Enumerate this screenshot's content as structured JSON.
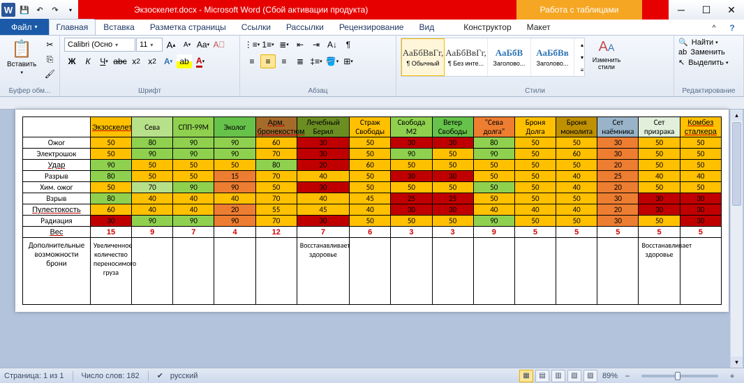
{
  "title": "Экзоскелет.docx - Microsoft Word (Сбой активации продукта)",
  "tableTools": "Работа с таблицами",
  "tabs": {
    "file": "Файл",
    "home": "Главная",
    "insert": "Вставка",
    "layout": "Разметка страницы",
    "refs": "Ссылки",
    "mail": "Рассылки",
    "review": "Рецензирование",
    "view": "Вид",
    "ctx1": "Конструктор",
    "ctx2": "Макет"
  },
  "ribbon": {
    "paste": "Вставить",
    "clipboard": "Буфер обм...",
    "fontName": "Calibri (Осно",
    "fontSize": "11",
    "fontGroup": "Шрифт",
    "paraGroup": "Абзац",
    "styles": [
      "АаБбВвГг,",
      "АаБбВвГг,",
      "АаБбВ",
      "АаБбВв"
    ],
    "styleNames": [
      "¶ Обычный",
      "¶ Без инте...",
      "Заголово...",
      "Заголово..."
    ],
    "stylesGroup": "Стили",
    "changeStyles": "Изменить стили",
    "find": "Найти",
    "replace": "Заменить",
    "select": "Выделить",
    "editGroup": "Редактирование"
  },
  "table": {
    "cols": [
      "Экзоскелет",
      "Сева",
      "СПП-99М",
      "Эколог",
      "Арм. бронекостюм",
      "Лечебный Берил",
      "Страж Свободы",
      "Свобода М2",
      "Ветер Свободы",
      "\"Сева долга\"",
      "Броня Долга",
      "Броня монолита",
      "Сет наёмника",
      "Сет призрака",
      "Комбез сталкера"
    ],
    "colStyles": [
      "c-y u",
      "c-g3",
      "c-g1",
      "c-g2",
      "c-br u",
      "c-ol",
      "c-y",
      "c-g1",
      "c-g2",
      "c-o",
      "c-y",
      "c-go",
      "c-be",
      "c-lg",
      "c-y u"
    ],
    "rows": [
      {
        "h": "Ожог",
        "v": [
          [
            "50",
            "c-y"
          ],
          [
            "80",
            "c-g1"
          ],
          [
            "90",
            "c-g1"
          ],
          [
            "90",
            "c-g1"
          ],
          [
            "60",
            "c-y"
          ],
          [
            "30",
            "c-r"
          ],
          [
            "50",
            "c-y"
          ],
          [
            "30",
            "c-r"
          ],
          [
            "30",
            "c-r"
          ],
          [
            "80",
            "c-g1"
          ],
          [
            "50",
            "c-y"
          ],
          [
            "50",
            "c-y"
          ],
          [
            "30",
            "c-o"
          ],
          [
            "50",
            "c-y"
          ],
          [
            "50",
            "c-y"
          ]
        ]
      },
      {
        "h": "Электрошок",
        "v": [
          [
            "50",
            "c-y"
          ],
          [
            "90",
            "c-g1"
          ],
          [
            "90",
            "c-g1"
          ],
          [
            "90",
            "c-g1"
          ],
          [
            "70",
            "c-y"
          ],
          [
            "30",
            "c-r"
          ],
          [
            "50",
            "c-y"
          ],
          [
            "90",
            "c-g1"
          ],
          [
            "50",
            "c-y"
          ],
          [
            "90",
            "c-g1"
          ],
          [
            "50",
            "c-y"
          ],
          [
            "60",
            "c-y"
          ],
          [
            "30",
            "c-o"
          ],
          [
            "50",
            "c-y"
          ],
          [
            "50",
            "c-y"
          ]
        ]
      },
      {
        "h": "Удар",
        "u": true,
        "v": [
          [
            "90",
            "c-g1"
          ],
          [
            "50",
            "c-y"
          ],
          [
            "50",
            "c-y"
          ],
          [
            "50",
            "c-y"
          ],
          [
            "80",
            "c-g1"
          ],
          [
            "20",
            "c-r"
          ],
          [
            "60",
            "c-y"
          ],
          [
            "50",
            "c-y"
          ],
          [
            "50",
            "c-y"
          ],
          [
            "50",
            "c-y"
          ],
          [
            "50",
            "c-y"
          ],
          [
            "50",
            "c-y"
          ],
          [
            "20",
            "c-o"
          ],
          [
            "50",
            "c-y"
          ],
          [
            "50",
            "c-y"
          ]
        ]
      },
      {
        "h": "Разрыв",
        "v": [
          [
            "80",
            "c-g1"
          ],
          [
            "50",
            "c-y"
          ],
          [
            "50",
            "c-y"
          ],
          [
            "15",
            "c-o"
          ],
          [
            "70",
            "c-y"
          ],
          [
            "40",
            "c-y"
          ],
          [
            "50",
            "c-y"
          ],
          [
            "30",
            "c-r"
          ],
          [
            "30",
            "c-r"
          ],
          [
            "50",
            "c-y"
          ],
          [
            "50",
            "c-y"
          ],
          [
            "40",
            "c-y"
          ],
          [
            "25",
            "c-o"
          ],
          [
            "40",
            "c-y"
          ],
          [
            "40",
            "c-y"
          ]
        ]
      },
      {
        "h": "Хим. ожог",
        "v": [
          [
            "50",
            "c-y"
          ],
          [
            "70",
            "c-g3"
          ],
          [
            "90",
            "c-g1"
          ],
          [
            "90",
            "c-o"
          ],
          [
            "50",
            "c-y"
          ],
          [
            "30",
            "c-r"
          ],
          [
            "50",
            "c-y"
          ],
          [
            "50",
            "c-y"
          ],
          [
            "50",
            "c-y"
          ],
          [
            "50",
            "c-g1"
          ],
          [
            "50",
            "c-y"
          ],
          [
            "40",
            "c-y"
          ],
          [
            "20",
            "c-o"
          ],
          [
            "50",
            "c-y"
          ],
          [
            "50",
            "c-y"
          ]
        ]
      },
      {
        "h": "Взрыв",
        "v": [
          [
            "80",
            "c-g1"
          ],
          [
            "40",
            "c-y"
          ],
          [
            "40",
            "c-y"
          ],
          [
            "40",
            "c-y"
          ],
          [
            "70",
            "c-y"
          ],
          [
            "40",
            "c-y"
          ],
          [
            "45",
            "c-y"
          ],
          [
            "25",
            "c-r"
          ],
          [
            "25",
            "c-r"
          ],
          [
            "50",
            "c-y"
          ],
          [
            "50",
            "c-y"
          ],
          [
            "50",
            "c-y"
          ],
          [
            "30",
            "c-o"
          ],
          [
            "30",
            "c-r"
          ],
          [
            "30",
            "c-r"
          ]
        ]
      },
      {
        "h": "Пулестокость",
        "u": true,
        "v": [
          [
            "60",
            "c-y"
          ],
          [
            "40",
            "c-y"
          ],
          [
            "40",
            "c-y"
          ],
          [
            "20",
            "c-o"
          ],
          [
            "55",
            "c-y"
          ],
          [
            "45",
            "c-y"
          ],
          [
            "40",
            "c-y"
          ],
          [
            "30",
            "c-r"
          ],
          [
            "30",
            "c-r"
          ],
          [
            "40",
            "c-y"
          ],
          [
            "40",
            "c-y"
          ],
          [
            "40",
            "c-y"
          ],
          [
            "20",
            "c-o"
          ],
          [
            "30",
            "c-r"
          ],
          [
            "30",
            "c-r"
          ]
        ]
      },
      {
        "h": "Радиация",
        "v": [
          [
            "30",
            "c-r"
          ],
          [
            "90",
            "c-g1"
          ],
          [
            "90",
            "c-g1"
          ],
          [
            "90",
            "c-o"
          ],
          [
            "70",
            "c-y"
          ],
          [
            "30",
            "c-r"
          ],
          [
            "50",
            "c-y"
          ],
          [
            "50",
            "c-y"
          ],
          [
            "50",
            "c-y"
          ],
          [
            "90",
            "c-g1"
          ],
          [
            "50",
            "c-y"
          ],
          [
            "50",
            "c-y"
          ],
          [
            "30",
            "c-o"
          ],
          [
            "50",
            "c-y"
          ],
          [
            "30",
            "c-r"
          ]
        ]
      },
      {
        "h": "Вес",
        "u": true,
        "w": true,
        "v": [
          [
            "15",
            ""
          ],
          [
            "9",
            ""
          ],
          [
            "7",
            ""
          ],
          [
            "4",
            ""
          ],
          [
            "12",
            ""
          ],
          [
            "7",
            ""
          ],
          [
            "6",
            ""
          ],
          [
            "3",
            ""
          ],
          [
            "3",
            ""
          ],
          [
            "9",
            ""
          ],
          [
            "5",
            ""
          ],
          [
            "5",
            ""
          ],
          [
            "5",
            ""
          ],
          [
            "5",
            ""
          ],
          [
            "5",
            ""
          ]
        ]
      },
      {
        "h": "Дополнительные возможности брони",
        "tall": true,
        "v": [
          [
            "Увеличенное количество переносимого груза",
            ""
          ],
          [
            "",
            ""
          ],
          [
            "",
            ""
          ],
          [
            "",
            ""
          ],
          [
            "",
            ""
          ],
          [
            "Восстанавливает здоровье",
            ""
          ],
          [
            "",
            ""
          ],
          [
            "",
            ""
          ],
          [
            "",
            ""
          ],
          [
            "",
            ""
          ],
          [
            "",
            ""
          ],
          [
            "",
            ""
          ],
          [
            "",
            ""
          ],
          [
            "Восстанавливает здоровье",
            ""
          ],
          [
            "",
            ""
          ]
        ]
      }
    ]
  },
  "status": {
    "page": "Страница: 1 из 1",
    "words": "Число слов: 182",
    "lang": "русский",
    "zoom": "89%"
  }
}
